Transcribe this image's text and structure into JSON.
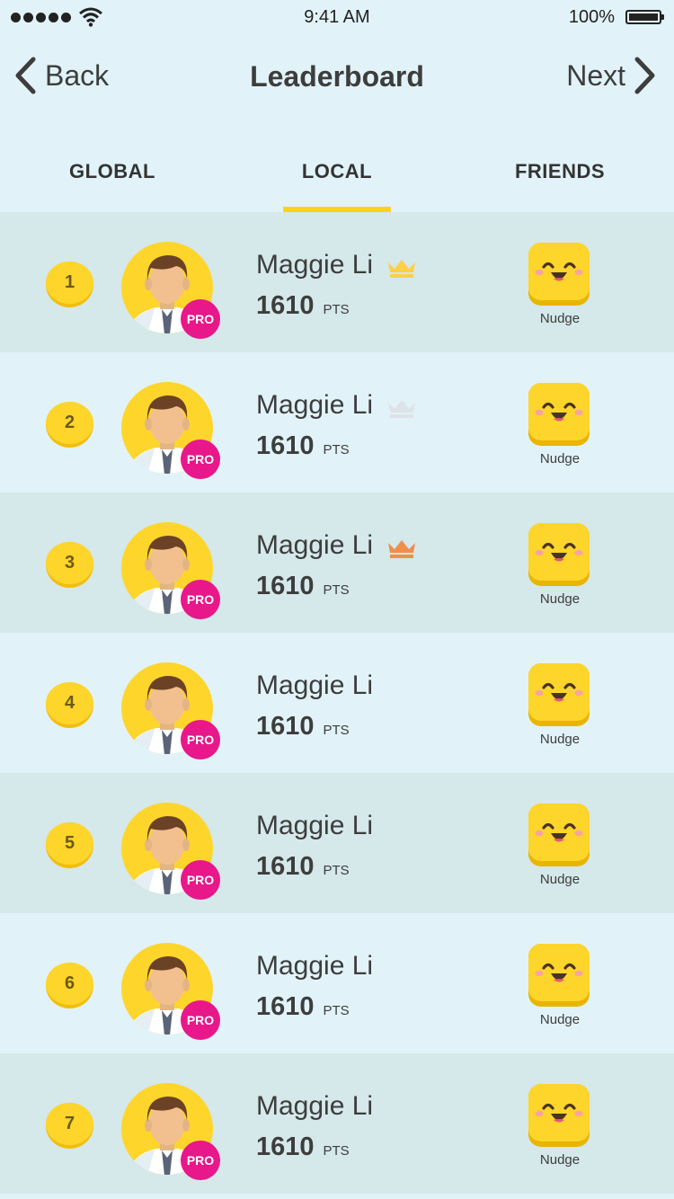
{
  "status_bar": {
    "time": "9:41 AM",
    "battery": "100%"
  },
  "nav": {
    "back_label": "Back",
    "title": "Leaderboard",
    "next_label": "Next"
  },
  "tabs": [
    {
      "label": "GLOBAL",
      "active": false
    },
    {
      "label": "LOCAL",
      "active": true
    },
    {
      "label": "FRIENDS",
      "active": false
    }
  ],
  "colors": {
    "accent": "#fdd21e",
    "pro": "#e8178a",
    "crown_gold": "#fdd047",
    "crown_silver": "#dde3e8",
    "crown_bronze": "#f08e4c"
  },
  "rows": [
    {
      "rank": "1",
      "name": "Maggie Li",
      "points": "1610",
      "unit": "PTS",
      "badge": "PRO",
      "crown": "gold",
      "nudge": "Nudge"
    },
    {
      "rank": "2",
      "name": "Maggie Li",
      "points": "1610",
      "unit": "PTS",
      "badge": "PRO",
      "crown": "silver",
      "nudge": "Nudge"
    },
    {
      "rank": "3",
      "name": "Maggie Li",
      "points": "1610",
      "unit": "PTS",
      "badge": "PRO",
      "crown": "bronze",
      "nudge": "Nudge"
    },
    {
      "rank": "4",
      "name": "Maggie Li",
      "points": "1610",
      "unit": "PTS",
      "badge": "PRO",
      "crown": "",
      "nudge": "Nudge"
    },
    {
      "rank": "5",
      "name": "Maggie Li",
      "points": "1610",
      "unit": "PTS",
      "badge": "PRO",
      "crown": "",
      "nudge": "Nudge"
    },
    {
      "rank": "6",
      "name": "Maggie Li",
      "points": "1610",
      "unit": "PTS",
      "badge": "PRO",
      "crown": "",
      "nudge": "Nudge"
    },
    {
      "rank": "7",
      "name": "Maggie Li",
      "points": "1610",
      "unit": "PTS",
      "badge": "PRO",
      "crown": "",
      "nudge": "Nudge"
    }
  ]
}
